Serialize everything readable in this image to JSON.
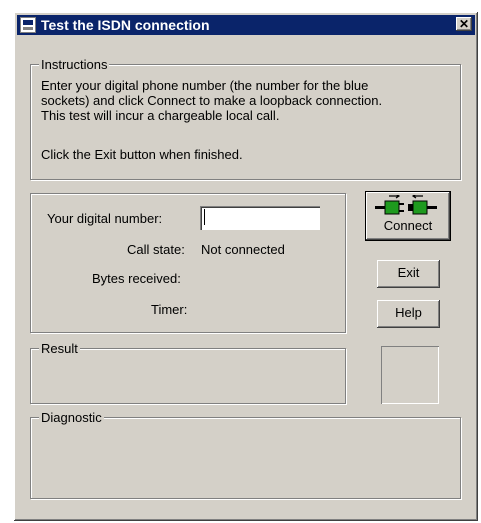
{
  "window": {
    "title": "Test the ISDN connection",
    "close_glyph": "✕"
  },
  "instructions": {
    "legend": "Instructions",
    "lines": [
      "Enter your digital phone number (the number for the blue",
      "sockets) and click Connect to make a loopback connection.",
      "This test will incur a chargeable local call.",
      "Click the Exit button when finished."
    ]
  },
  "status": {
    "number_label": "Your digital number:",
    "number_value": "",
    "call_state_label": "Call state:",
    "call_state_value": "Not connected",
    "bytes_label": "Bytes received:",
    "bytes_value": "",
    "timer_label": "Timer:",
    "timer_value": ""
  },
  "buttons": {
    "connect_label": "Connect",
    "connect_icon": "plug-connect-icon",
    "exit_label": "Exit",
    "help_label": "Help"
  },
  "result": {
    "legend": "Result"
  },
  "diagnostic": {
    "legend": "Diagnostic"
  },
  "colors": {
    "title_bar": "#0a246a",
    "face": "#d4d0c8",
    "plug_green": "#1e9a1e"
  }
}
